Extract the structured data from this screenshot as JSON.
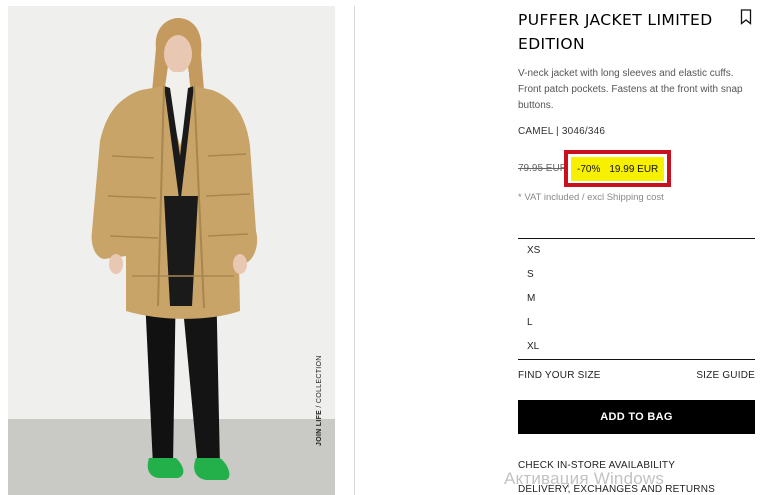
{
  "product": {
    "title": "PUFFER JACKET LIMITED EDITION",
    "description": "V-neck jacket with long sleeves and elastic cuffs. Front patch pockets. Fastens at the front with snap buttons.",
    "color_ref": "CAMEL | 3046/346",
    "old_price": "79.95 EUR",
    "discount": "-70%",
    "new_price": "19.99 EUR",
    "vat_note": "* VAT included / excl Shipping cost",
    "image_caption_bold": "JOIN LIFE",
    "image_caption_rest": " / COLLECTION"
  },
  "sizes": [
    "XS",
    "S",
    "M",
    "L",
    "XL"
  ],
  "actions": {
    "find_your_size": "FIND YOUR SIZE",
    "size_guide": "SIZE GUIDE",
    "add_to_bag": "ADD TO BAG",
    "check_store": "CHECK IN-STORE AVAILABILITY",
    "delivery": "DELIVERY, EXCHANGES AND RETURNS"
  },
  "overlay": {
    "watermark": "Активация Windows"
  },
  "colors": {
    "price_highlight": "#f7f100",
    "price_frame": "#c8101e",
    "button_bg": "#000000",
    "jacket": "#c9a468",
    "shoes": "#23b04a"
  },
  "icons": {
    "bookmark": "bookmark-icon"
  }
}
